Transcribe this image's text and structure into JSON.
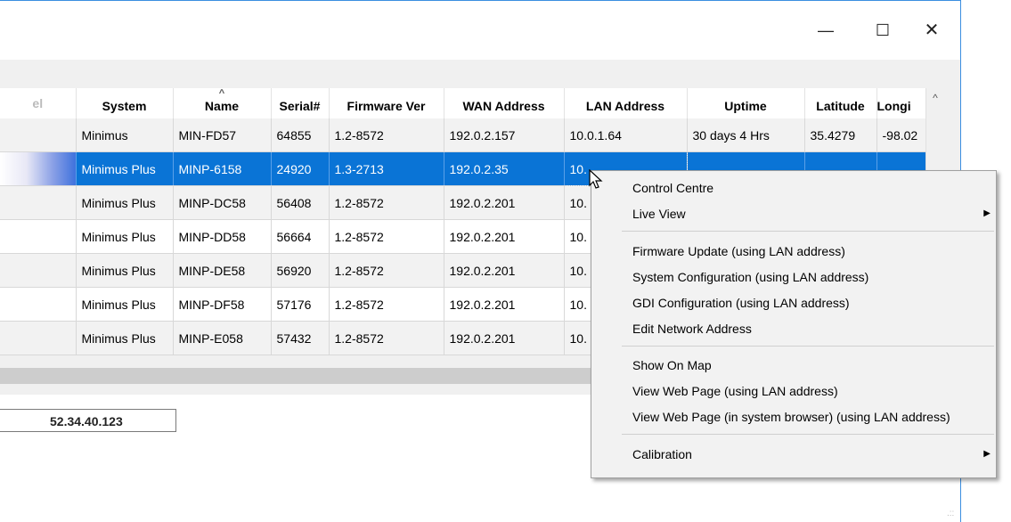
{
  "window": {
    "controls": {
      "minimize": "—",
      "maximize": "☐",
      "close": "✕"
    }
  },
  "grid": {
    "columns": [
      "el",
      "System",
      "Name",
      "Serial#",
      "Firmware Ver",
      "WAN Address",
      "LAN Address",
      "Uptime",
      "Latitude",
      "Longi"
    ],
    "sort_indicator": "^",
    "scroll_up": "^",
    "rows": [
      {
        "system": "Minimus",
        "name": "MIN-FD57",
        "serial": "64855",
        "firmware": "1.2-8572",
        "wan": "192.0.2.157",
        "lan": "10.0.1.64",
        "uptime": "30 days 4 Hrs",
        "latitude": "35.4279",
        "longitude": "-98.02"
      },
      {
        "system": "Minimus Plus",
        "name": "MINP-6158",
        "serial": "24920",
        "firmware": "1.3-2713",
        "wan": "192.0.2.35",
        "lan": "10.",
        "uptime": "",
        "latitude": "",
        "longitude": ""
      },
      {
        "system": "Minimus Plus",
        "name": "MINP-DC58",
        "serial": "56408",
        "firmware": "1.2-8572",
        "wan": "192.0.2.201",
        "lan": "10.",
        "uptime": "",
        "latitude": "",
        "longitude": ""
      },
      {
        "system": "Minimus Plus",
        "name": "MINP-DD58",
        "serial": "56664",
        "firmware": "1.2-8572",
        "wan": "192.0.2.201",
        "lan": "10.",
        "uptime": "",
        "latitude": "",
        "longitude": ""
      },
      {
        "system": "Minimus Plus",
        "name": "MINP-DE58",
        "serial": "56920",
        "firmware": "1.2-8572",
        "wan": "192.0.2.201",
        "lan": "10.",
        "uptime": "",
        "latitude": "",
        "longitude": ""
      },
      {
        "system": "Minimus Plus",
        "name": "MINP-DF58",
        "serial": "57176",
        "firmware": "1.2-8572",
        "wan": "192.0.2.201",
        "lan": "10.",
        "uptime": "",
        "latitude": "",
        "longitude": ""
      },
      {
        "system": "Minimus Plus",
        "name": "MINP-E058",
        "serial": "57432",
        "firmware": "1.2-8572",
        "wan": "192.0.2.201",
        "lan": "10.",
        "uptime": "",
        "latitude": "",
        "longitude": ""
      }
    ]
  },
  "ip_field": {
    "value": "52.34.40.123"
  },
  "context_menu": {
    "items": [
      {
        "label": "Control Centre",
        "submenu": false
      },
      {
        "label": "Live View",
        "submenu": true
      },
      {
        "label": "Firmware Update (using LAN address)",
        "submenu": false
      },
      {
        "label": "System Configuration (using LAN address)",
        "submenu": false
      },
      {
        "label": "GDI Configuration (using LAN address)",
        "submenu": false
      },
      {
        "label": "Edit Network Address",
        "submenu": false
      },
      {
        "label": "Show On Map",
        "submenu": false
      },
      {
        "label": "View Web Page (using LAN address)",
        "submenu": false
      },
      {
        "label": "View Web Page (in system browser) (using LAN address)",
        "submenu": false
      },
      {
        "label": "Calibration",
        "submenu": true
      }
    ],
    "submenu_arrow": "▶"
  },
  "colors": {
    "selection": "#0a74d6",
    "window_border": "#3b8ee0",
    "menu_background": "#f2f2f2"
  }
}
